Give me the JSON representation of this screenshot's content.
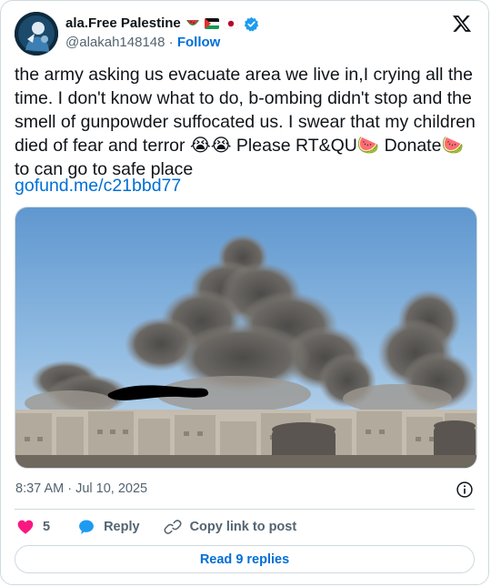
{
  "author": {
    "name": "ala.Free Palestine",
    "flags": [
      "watermelon",
      "palestine-flag",
      "japan-flag"
    ],
    "handle": "@alakah148148",
    "separator": "·",
    "follow_label": "Follow",
    "verified": true
  },
  "tweet": {
    "text": "the army asking us evacuate area we live in,I crying all the time. I don't know what to do, b-ombing didn't stop and the smell of gunpowder suffocated us. I swear that my children died of fear and terror 😭😭 Please RT&QU🍉 Donate🍉  to can go to safe place",
    "link": "gofund.me/c21bbd77",
    "timestamp": "8:37 AM · Jul 10, 2025"
  },
  "actions": {
    "like_count": "5",
    "reply_label": "Reply",
    "copy_label": "Copy link to post"
  },
  "read_replies_label": "Read 9 replies",
  "colors": {
    "accent": "#006fd6",
    "like": "#f91880",
    "reply": "#1d9bf0",
    "muted": "#536471",
    "border": "#cfd9de"
  },
  "icons": [
    "x-logo-icon",
    "verified-badge-icon",
    "info-icon",
    "heart-icon",
    "reply-bubble-icon",
    "link-icon"
  ]
}
